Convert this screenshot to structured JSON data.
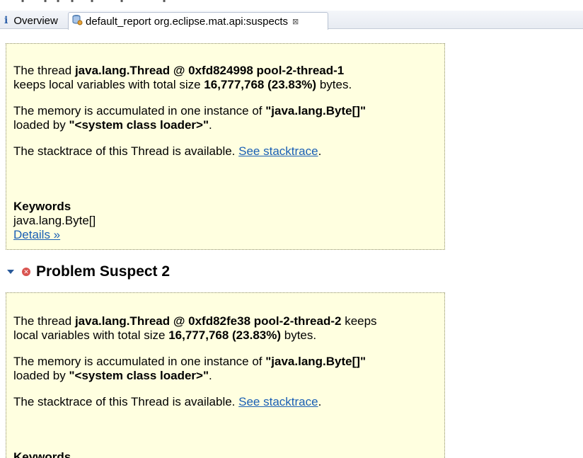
{
  "tabs": {
    "overview_label": "Overview",
    "report_label": "default_report  org.eclipse.mat.api:suspects",
    "close_glyph": "⊠",
    "info_glyph": "i"
  },
  "suspect1": {
    "thread_prefix": "The thread ",
    "thread_name": "java.lang.Thread @ 0xfd824998 pool-2-thread-1",
    "size_prefix": "keeps local variables with total size ",
    "size_value": "16,777,768 (23.83%)",
    "size_suffix": " bytes.",
    "mem_prefix": "The memory is accumulated in one instance of ",
    "mem_class": "\"java.lang.Byte[]\"",
    "loaded_prefix": "loaded by ",
    "loader": "\"<system class loader>\"",
    "loaded_suffix": ".",
    "stack_text": "The stacktrace of this Thread is available. ",
    "stack_link": "See stacktrace",
    "stack_suffix": ".",
    "keywords_label": "Keywords",
    "keyword": "java.lang.Byte[]",
    "details_link": "Details »"
  },
  "suspect2": {
    "heading": "Problem Suspect 2",
    "thread_prefix": "The thread ",
    "thread_name": "java.lang.Thread @ 0xfd82fe38 pool-2-thread-2",
    "keeps": " keeps",
    "size_prefix": "local variables with total size ",
    "size_value": "16,777,768 (23.83%)",
    "size_suffix": " bytes.",
    "mem_prefix": "The memory is accumulated in one instance of ",
    "mem_class": "\"java.lang.Byte[]\"",
    "loaded_prefix": "loaded by ",
    "loader": "\"<system class loader>\"",
    "loaded_suffix": ".",
    "stack_text": "The stacktrace of this Thread is available. ",
    "stack_link": "See stacktrace",
    "stack_suffix": ".",
    "keywords_label": "Keywords"
  }
}
